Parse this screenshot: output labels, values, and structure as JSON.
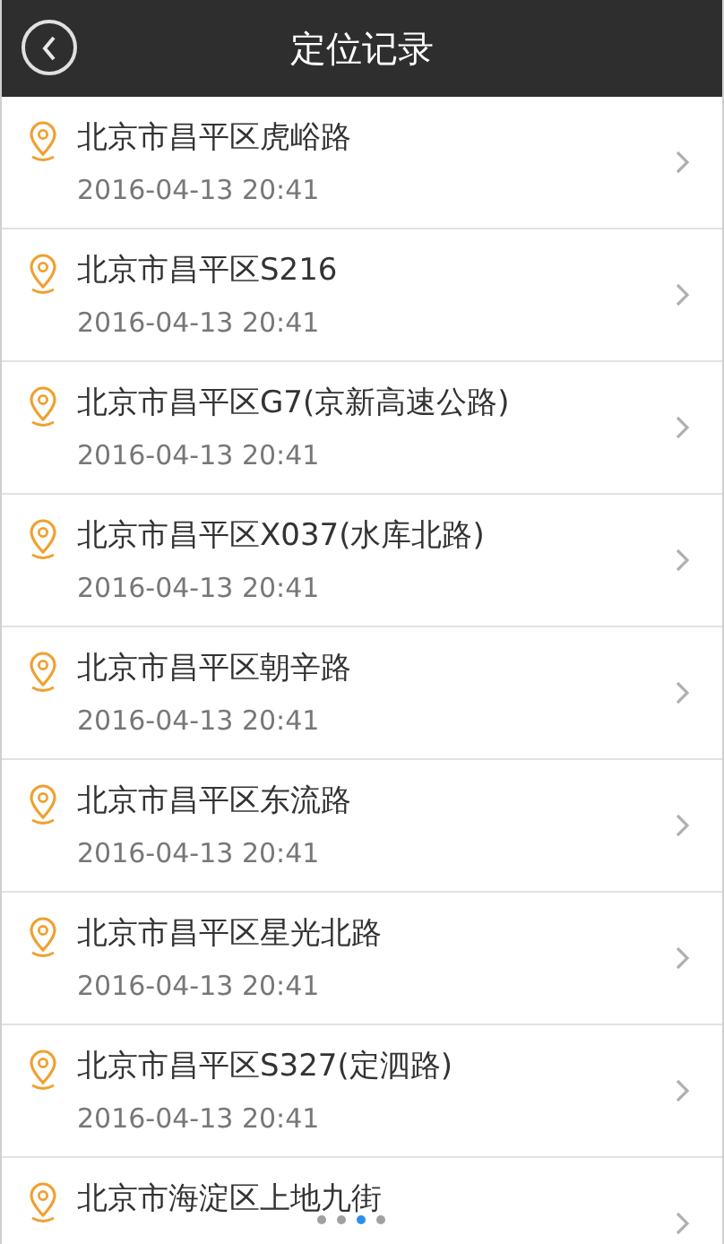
{
  "header": {
    "title": "定位记录"
  },
  "records": [
    {
      "place": "北京市昌平区虎峪路",
      "time": "2016-04-13 20:41"
    },
    {
      "place": "北京市昌平区S216",
      "time": "2016-04-13 20:41"
    },
    {
      "place": "北京市昌平区G7(京新高速公路)",
      "time": "2016-04-13 20:41"
    },
    {
      "place": "北京市昌平区X037(水库北路)",
      "time": "2016-04-13 20:41"
    },
    {
      "place": "北京市昌平区朝辛路",
      "time": "2016-04-13 20:41"
    },
    {
      "place": "北京市昌平区东流路",
      "time": "2016-04-13 20:41"
    },
    {
      "place": "北京市昌平区星光北路",
      "time": "2016-04-13 20:41"
    },
    {
      "place": "北京市昌平区S327(定泗路)",
      "time": "2016-04-13 20:41"
    },
    {
      "place": "北京市海淀区上地九街"
    }
  ],
  "page_dots": [
    {
      "selected": false
    },
    {
      "selected": false
    },
    {
      "selected": true
    },
    {
      "selected": false
    }
  ]
}
